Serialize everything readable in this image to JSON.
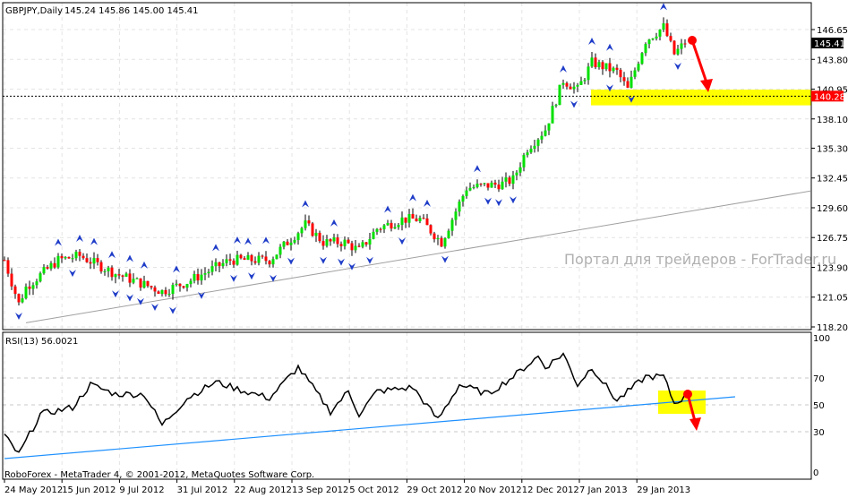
{
  "chart_data": [
    {
      "type": "candlestick",
      "symbol": "GBPJPY,Daily",
      "ohlc_label": "145.24 145.86 145.00 145.41",
      "yticks": [
        "146.65",
        "143.80",
        "140.95",
        "138.10",
        "135.30",
        "132.45",
        "129.60",
        "126.75",
        "123.90",
        "121.05",
        "118.20"
      ],
      "ylim": [
        118.2,
        146.65
      ],
      "current_price": "145.41",
      "level_price": "140.28",
      "close_keypoints": [
        [
          0,
          124.6
        ],
        [
          4,
          120.4
        ],
        [
          6,
          122
        ],
        [
          15,
          124.6
        ],
        [
          21,
          125
        ],
        [
          31,
          123.3
        ],
        [
          44,
          121.6
        ],
        [
          51,
          122.5
        ],
        [
          63,
          124.6
        ],
        [
          74,
          124.6
        ],
        [
          84,
          128.0
        ],
        [
          89,
          126.3
        ],
        [
          95,
          126.3
        ],
        [
          99,
          125.5
        ],
        [
          104,
          127.6
        ],
        [
          111,
          128.5
        ],
        [
          116,
          128.5
        ],
        [
          122,
          126.3
        ],
        [
          129,
          131.5
        ],
        [
          139,
          131.9
        ],
        [
          142,
          132.3
        ],
        [
          146,
          135.3
        ],
        [
          151,
          137.1
        ],
        [
          156,
          141.8
        ],
        [
          160,
          140.9
        ],
        [
          164,
          143.5
        ],
        [
          171,
          142.6
        ],
        [
          174,
          140.9
        ],
        [
          179,
          145.6
        ],
        [
          184,
          146.9
        ],
        [
          187,
          144.3
        ],
        [
          190,
          145.4
        ]
      ],
      "trendline": [
        [
          6,
          118.6
        ],
        [
          225,
          131.2
        ]
      ],
      "support_zone": [
        139.4,
        140.9
      ],
      "watermark": "Портал для трейдеров - ForTrader.ru"
    },
    {
      "type": "line",
      "title": "RSI(13) 56.0021",
      "yticks": [
        "100",
        "70",
        "50",
        "30",
        "0"
      ],
      "ylim": [
        0,
        100
      ],
      "keypoints": [
        [
          0,
          27
        ],
        [
          4,
          13
        ],
        [
          10,
          43
        ],
        [
          19,
          48
        ],
        [
          24,
          65
        ],
        [
          31,
          58
        ],
        [
          39,
          58
        ],
        [
          44,
          35
        ],
        [
          51,
          55
        ],
        [
          59,
          67
        ],
        [
          66,
          61
        ],
        [
          74,
          55
        ],
        [
          82,
          78
        ],
        [
          91,
          45
        ],
        [
          96,
          60
        ],
        [
          99,
          43
        ],
        [
          104,
          60
        ],
        [
          114,
          63
        ],
        [
          121,
          39
        ],
        [
          127,
          65
        ],
        [
          135,
          58
        ],
        [
          142,
          71
        ],
        [
          149,
          86
        ],
        [
          151,
          78
        ],
        [
          156,
          88
        ],
        [
          160,
          65
        ],
        [
          164,
          78
        ],
        [
          171,
          53
        ],
        [
          179,
          71
        ],
        [
          184,
          71
        ],
        [
          187,
          51
        ],
        [
          191,
          58
        ]
      ],
      "trendline": [
        [
          0,
          10
        ],
        [
          204,
          56
        ]
      ]
    }
  ],
  "xticks": [
    "24 May 2012",
    "15 Jun 2012",
    "9 Jul 2012",
    "31 Jul 2012",
    "22 Aug 2012",
    "13 Sep 2012",
    "5 Oct 2012",
    "29 Oct 2012",
    "20 Nov 2012",
    "12 Dec 2012",
    "7 Jan 2013",
    "29 Jan 2013"
  ],
  "footer": "RoboForex - MetaTrader 4, © 2001-2012, MetaQuotes Software Corp.",
  "colors": {
    "up": "#00e000",
    "down": "#ff0000",
    "fractal": "#1e3cc8",
    "zone": "#ffff00",
    "rsi_trend": "#1e90ff",
    "arrow": "#ff0000"
  }
}
